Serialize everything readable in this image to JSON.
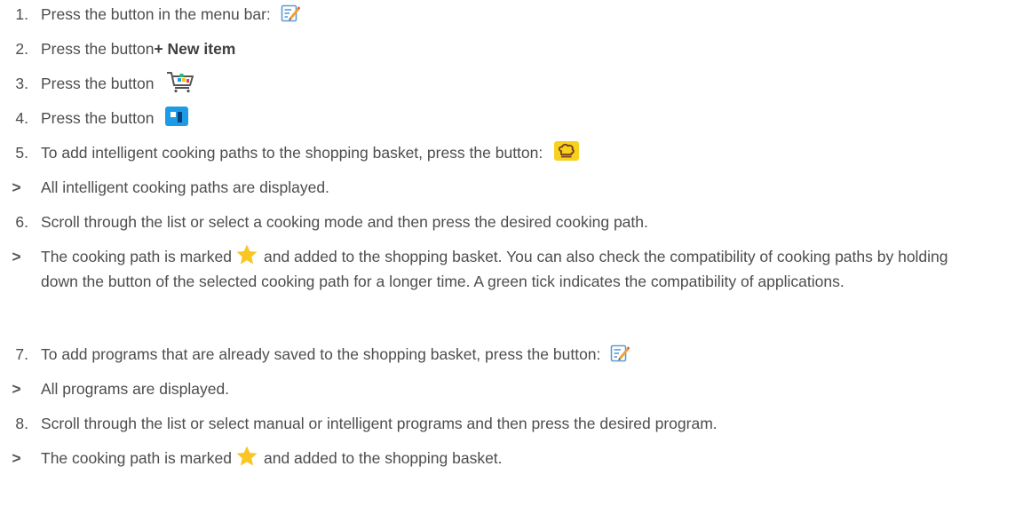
{
  "steps": [
    {
      "marker": "1.",
      "text": "Press the button in the menu bar:",
      "icon": "edit-icon"
    },
    {
      "marker": "2.",
      "text": "Press the button",
      "bold": "+ New item"
    },
    {
      "marker": "3.",
      "text": "Press the button",
      "icon": "shopping-cart-icon"
    },
    {
      "marker": "4.",
      "text": "Press the button",
      "icon": "blue-tile-icon"
    },
    {
      "marker": "5.",
      "text": "To add intelligent cooking paths to the shopping basket, press the button:",
      "icon": "chef-hat-icon"
    },
    {
      "marker": ">",
      "text": "All intelligent cooking paths are displayed."
    },
    {
      "marker": "6.",
      "text": "Scroll through the list or select a cooking mode and then press the desired cooking path."
    },
    {
      "marker": ">",
      "text_before": "The cooking path is marked",
      "icon": "star-icon",
      "text_after": "and added to the shopping basket. You can also check the compatibility of cooking paths by holding down the button of the selected cooking path for a longer time. A green tick indicates the compatibility of applications."
    },
    {
      "marker": "7.",
      "text": "To add programs that are already saved to the shopping basket, press the button:",
      "icon": "edit-icon"
    },
    {
      "marker": ">",
      "text": "All programs are displayed."
    },
    {
      "marker": "8.",
      "text": "Scroll through the list or select manual or intelligent programs and then press the desired program."
    },
    {
      "marker": ">",
      "text_before": "The cooking path is marked",
      "icon": "star-icon",
      "text_after": "and added to the shopping basket."
    }
  ],
  "colors": {
    "text": "#4d4d4d",
    "edit_icon_blue": "#5b9bd5",
    "edit_icon_orange": "#f0a030",
    "chef_icon_yellow": "#f7d21c",
    "tile_icon_blue": "#1e9be6",
    "star_yellow": "#f9c623"
  }
}
